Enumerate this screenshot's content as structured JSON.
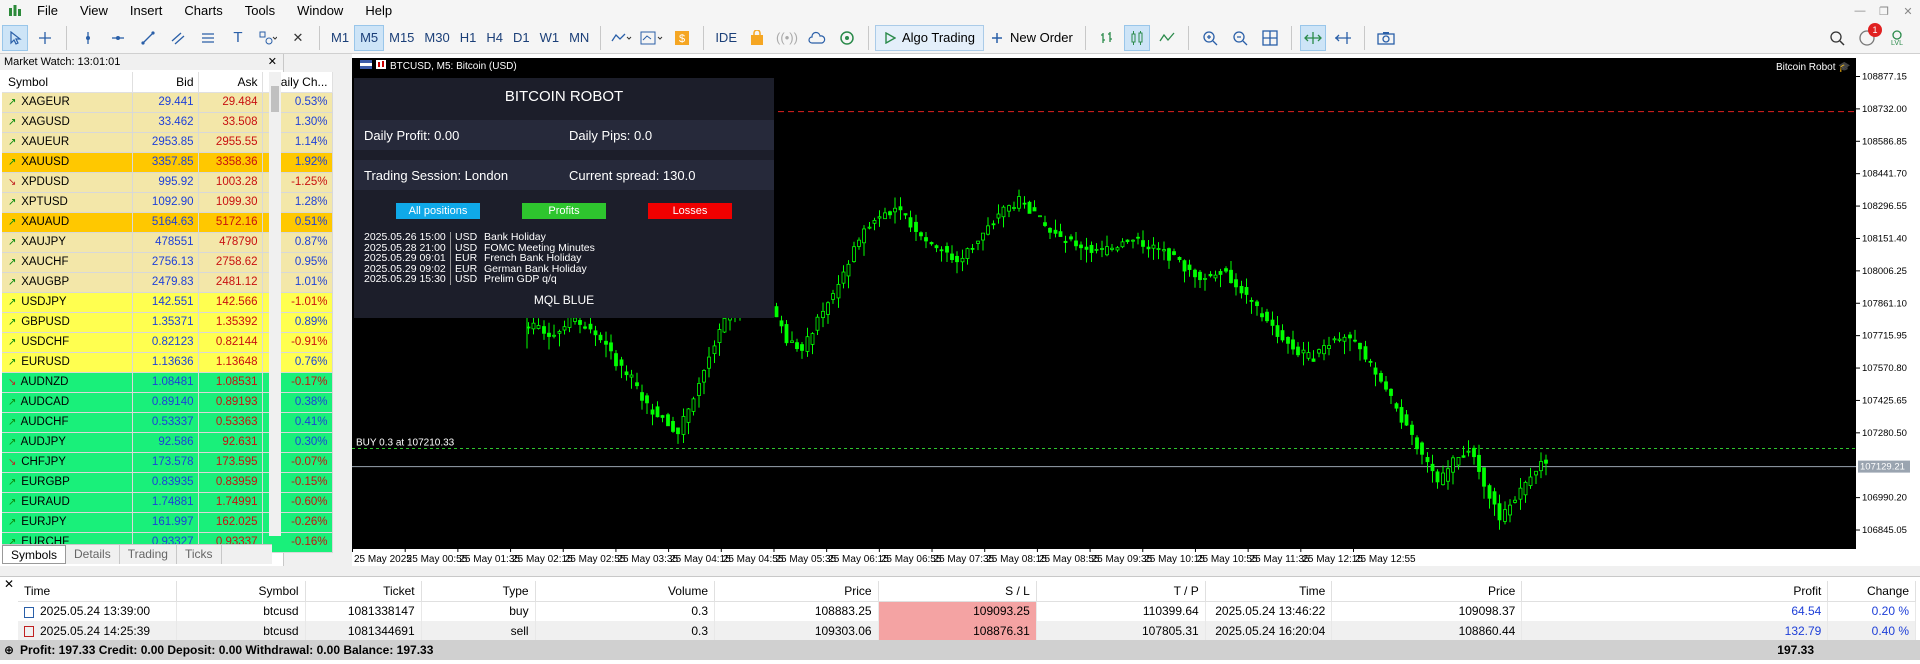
{
  "menu": [
    "File",
    "View",
    "Insert",
    "Charts",
    "Tools",
    "Window",
    "Help"
  ],
  "timeframes": [
    {
      "label": "M1",
      "active": false
    },
    {
      "label": "M5",
      "active": true
    },
    {
      "label": "M15",
      "active": false
    },
    {
      "label": "M30",
      "active": false
    },
    {
      "label": "H1",
      "active": false
    },
    {
      "label": "H4",
      "active": false
    },
    {
      "label": "D1",
      "active": false
    },
    {
      "label": "W1",
      "active": false
    },
    {
      "label": "MN",
      "active": false
    }
  ],
  "toolbar": {
    "ide_label": "IDE",
    "algo_label": "Algo Trading",
    "new_order_label": "New Order",
    "notification_count": "1",
    "level_badge": "LVL"
  },
  "market_watch": {
    "title": "Market Watch: 13:01:01",
    "columns": [
      "Symbol",
      "Bid",
      "Ask",
      "Daily Ch..."
    ],
    "rows": [
      {
        "symbol": "XAGEUR",
        "bid": "29.441",
        "ask": "29.484",
        "change": "0.53%",
        "dir": "up",
        "bg": "#f3e7a9"
      },
      {
        "symbol": "XAGUSD",
        "bid": "33.462",
        "ask": "33.508",
        "change": "1.30%",
        "dir": "up",
        "bg": "#f3e7a9"
      },
      {
        "symbol": "XAUEUR",
        "bid": "2953.85",
        "ask": "2955.55",
        "change": "1.14%",
        "dir": "up",
        "bg": "#f3e7a9"
      },
      {
        "symbol": "XAUUSD",
        "bid": "3357.85",
        "ask": "3358.36",
        "change": "1.92%",
        "dir": "up",
        "bg": "#ffc800"
      },
      {
        "symbol": "XPDUSD",
        "bid": "995.92",
        "ask": "1003.28",
        "change": "-1.25%",
        "dir": "dn",
        "bg": "#f3e7a9"
      },
      {
        "symbol": "XPTUSD",
        "bid": "1092.90",
        "ask": "1099.30",
        "change": "1.28%",
        "dir": "up",
        "bg": "#f3e7a9"
      },
      {
        "symbol": "XAUAUD",
        "bid": "5164.63",
        "ask": "5172.16",
        "change": "0.51%",
        "dir": "up",
        "bg": "#ffc800"
      },
      {
        "symbol": "XAUJPY",
        "bid": "478551",
        "ask": "478790",
        "change": "0.87%",
        "dir": "up",
        "bg": "#f3e7a9"
      },
      {
        "symbol": "XAUCHF",
        "bid": "2756.13",
        "ask": "2758.62",
        "change": "0.95%",
        "dir": "up",
        "bg": "#f3e7a9"
      },
      {
        "symbol": "XAUGBP",
        "bid": "2479.83",
        "ask": "2481.12",
        "change": "1.01%",
        "dir": "up",
        "bg": "#f3e7a9"
      },
      {
        "symbol": "USDJPY",
        "bid": "142.551",
        "ask": "142.566",
        "change": "-1.01%",
        "dir": "up",
        "bg": "#ffff50"
      },
      {
        "symbol": "GBPUSD",
        "bid": "1.35371",
        "ask": "1.35392",
        "change": "0.89%",
        "dir": "up",
        "bg": "#ffff50"
      },
      {
        "symbol": "USDCHF",
        "bid": "0.82123",
        "ask": "0.82144",
        "change": "-0.91%",
        "dir": "up",
        "bg": "#ffff50"
      },
      {
        "symbol": "EURUSD",
        "bid": "1.13636",
        "ask": "1.13648",
        "change": "0.76%",
        "dir": "up",
        "bg": "#ffff50"
      },
      {
        "symbol": "AUDNZD",
        "bid": "1.08481",
        "ask": "1.08531",
        "change": "-0.17%",
        "dir": "dn",
        "bg": "#19f07a"
      },
      {
        "symbol": "AUDCAD",
        "bid": "0.89140",
        "ask": "0.89193",
        "change": "0.38%",
        "dir": "up",
        "bg": "#19f07a"
      },
      {
        "symbol": "AUDCHF",
        "bid": "0.53337",
        "ask": "0.53363",
        "change": "0.41%",
        "dir": "up",
        "bg": "#19f07a"
      },
      {
        "symbol": "AUDJPY",
        "bid": "92.586",
        "ask": "92.631",
        "change": "0.30%",
        "dir": "up",
        "bg": "#19f07a"
      },
      {
        "symbol": "CHFJPY",
        "bid": "173.578",
        "ask": "173.595",
        "change": "-0.07%",
        "dir": "dn",
        "bg": "#19f07a"
      },
      {
        "symbol": "EURGBP",
        "bid": "0.83935",
        "ask": "0.83959",
        "change": "-0.15%",
        "dir": "up",
        "bg": "#19f07a"
      },
      {
        "symbol": "EURAUD",
        "bid": "1.74881",
        "ask": "1.74991",
        "change": "-0.60%",
        "dir": "up",
        "bg": "#19f07a"
      },
      {
        "symbol": "EURJPY",
        "bid": "161.997",
        "ask": "162.025",
        "change": "-0.26%",
        "dir": "up",
        "bg": "#19f07a"
      },
      {
        "symbol": "EURCHF",
        "bid": "0.93327",
        "ask": "0.93337",
        "change": "-0.16%",
        "dir": "up",
        "bg": "#19f07a"
      }
    ],
    "tabs": [
      "Symbols",
      "Details",
      "Trading",
      "Ticks"
    ]
  },
  "chart": {
    "title": "BTCUSD, M5: Bitcoin (USD)",
    "robot_tag": "Bitcoin Robot",
    "buy_label": "BUY 0.3 at 107210.33",
    "current_price": "107129.21",
    "price_ticks": [
      "108877.15",
      "108732.00",
      "108586.85",
      "108441.70",
      "108296.55",
      "108151.40",
      "108006.25",
      "107861.10",
      "107715.95",
      "107570.80",
      "107425.65",
      "107280.50",
      "106990.20",
      "106845.05"
    ],
    "price_range": [
      106760,
      108960
    ],
    "buy_price": 107210.33,
    "red_line_price": 108720,
    "time_ticks": [
      "25 May 2025",
      "25 May 00:55",
      "25 May 01:35",
      "25 May 02:15",
      "25 May 02:55",
      "25 May 03:35",
      "25 May 04:15",
      "25 May 04:55",
      "25 May 05:35",
      "25 May 06:15",
      "25 May 06:55",
      "25 May 07:35",
      "25 May 08:15",
      "25 May 08:55",
      "25 May 09:35",
      "25 May 10:15",
      "25 May 10:55",
      "25 May 11:35",
      "25 May 12:15",
      "25 May 12:55"
    ],
    "candle_color": "#00ff00"
  },
  "panel": {
    "title": "BITCOIN ROBOT",
    "daily_profit": "Daily Profit: 0.00",
    "daily_pips": "Daily Pips:  0.0",
    "session": "Trading Session: London",
    "spread": "Current spread: 130.0",
    "btn_all": "All positions",
    "btn_profits": "Profits",
    "btn_losses": "Losses",
    "news": [
      {
        "time": "2025.05.26 15:00",
        "cur": "USD",
        "event": "Bank Holiday"
      },
      {
        "time": "2025.05.28 21:00",
        "cur": "USD",
        "event": "FOMC Meeting Minutes"
      },
      {
        "time": "2025.05.29 09:01",
        "cur": "EUR",
        "event": "French Bank Holiday"
      },
      {
        "time": "2025.05.29 09:02",
        "cur": "EUR",
        "event": "German Bank Holiday"
      },
      {
        "time": "2025.05.29 15:30",
        "cur": "USD",
        "event": "Prelim GDP q/q"
      }
    ],
    "footer": "MQL BLUE"
  },
  "terminal": {
    "columns": [
      "Time",
      "Symbol",
      "Ticket",
      "Type",
      "Volume",
      "Price",
      "S / L",
      "T / P",
      "Time",
      "Price",
      "Profit",
      "Change"
    ],
    "rows": [
      {
        "time": "2025.05.24 13:39:00",
        "symbol": "btcusd",
        "ticket": "1081338147",
        "type": "buy",
        "volume": "0.3",
        "price": "108883.25",
        "sl": "109093.25",
        "tp": "110399.64",
        "time2": "2025.05.24 13:46:22",
        "price2": "109098.37",
        "profit": "64.54",
        "change": "0.20 %"
      },
      {
        "time": "2025.05.24 14:25:39",
        "symbol": "btcusd",
        "ticket": "1081344691",
        "type": "sell",
        "volume": "0.3",
        "price": "109303.06",
        "sl": "108876.31",
        "tp": "107805.31",
        "time2": "2025.05.24 16:20:04",
        "price2": "108860.44",
        "profit": "132.79",
        "change": "0.40 %"
      }
    ],
    "balance_line": "Profit: 197.33  Credit: 0.00  Deposit: 0.00  Withdrawal: 0.00  Balance: 197.33",
    "total": "197.33"
  },
  "chart_data": {
    "type": "candlestick",
    "series": [
      {
        "values": [
          107750,
          107720,
          107790,
          107760,
          107700,
          107600,
          107520,
          107400,
          107350,
          107280,
          107450,
          107620,
          107780,
          107900,
          108000,
          107850,
          107700,
          107650,
          107780,
          107900,
          108050,
          108200,
          108260,
          108280,
          108220,
          108150,
          108100,
          108050,
          108120,
          108200,
          108280,
          108320,
          108260,
          108180,
          108140,
          108120,
          108090,
          108110,
          108150,
          108130,
          108100,
          108060,
          108000,
          107980,
          108010,
          107950,
          107860,
          107780,
          107700,
          107640,
          107620,
          107690,
          107720,
          107650,
          107550,
          107430,
          107300,
          107180,
          107050,
          107150,
          107210,
          107060,
          106900,
          106980,
          107100,
          107160
        ]
      }
    ]
  }
}
